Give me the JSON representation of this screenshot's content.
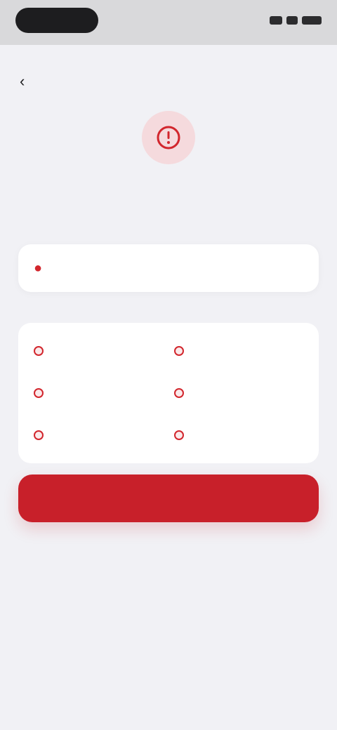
{
  "status_bar": {
    "time": ""
  },
  "header": {
    "back_label": ""
  },
  "hero": {
    "icon": "alert-location-icon",
    "accent": "#d2262d",
    "bg": "#f5dadd"
  },
  "title": "",
  "subtitle": "",
  "search": {
    "value": "",
    "placeholder": "",
    "icon": "location-pin-icon"
  },
  "section": {
    "label": "",
    "action": ""
  },
  "options": [
    {
      "label": ""
    },
    {
      "label": ""
    },
    {
      "label": ""
    },
    {
      "label": ""
    },
    {
      "label": ""
    },
    {
      "label": ""
    }
  ],
  "primary_button": {
    "label": ""
  },
  "colors": {
    "accent": "#c8202a",
    "background": "#f1f1f5",
    "card": "#ffffff"
  }
}
